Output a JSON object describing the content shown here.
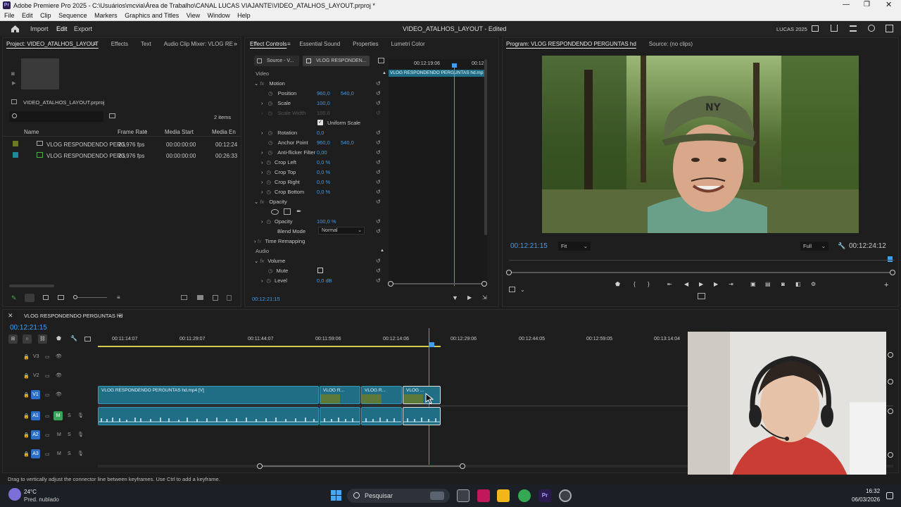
{
  "window": {
    "title": "Adobe Premiere Pro 2025 - C:\\Usuários\\mcvia\\Área de Trabalho\\CANAL LUCAS VIAJANTE\\VIDEO_ATALHOS_LAYOUT.prproj *"
  },
  "menu": [
    "File",
    "Edit",
    "Clip",
    "Sequence",
    "Markers",
    "Graphics and Titles",
    "View",
    "Window",
    "Help"
  ],
  "header": {
    "nav": [
      "Import",
      "Edit",
      "Export"
    ],
    "project_title": "VIDEO_ATALHOS_LAYOUT - Edited",
    "workspace": "LUCAS 2025"
  },
  "project_panel": {
    "tabs": [
      "Project: VIDEO_ATALHOS_LAYOUT",
      "Effects",
      "Text",
      "Audio Clip Mixer: VLOG RE"
    ],
    "file": "VIDEO_ATALHOS_LAYOUT.prproj",
    "item_count": "2 items",
    "columns": [
      "Name",
      "Frame Rate",
      "Media Start",
      "Media En"
    ],
    "rows": [
      {
        "name": "VLOG RESPONDENDO PERG",
        "fps": "23,976 fps",
        "start": "00:00:00:00",
        "end": "00:12:24",
        "color": "#6b7b1e"
      },
      {
        "name": "VLOG RESPONDENDO PERG",
        "fps": "23,976 fps",
        "start": "00:00:00:00",
        "end": "00:26:33",
        "color": "#1f8a9a"
      }
    ]
  },
  "effect_controls": {
    "tabs": [
      "Effect Controls",
      "Essential Sound",
      "Properties",
      "Lumetri Color"
    ],
    "source_label": "Source - V...",
    "clip_label": "VLOG RESPONDEN...",
    "ruler_time_1": "00:12:19:06",
    "ruler_time_2": "00:12:",
    "clip_bar": "VLOG RESPONDENDO PERGUNTAS hd.mp",
    "section_video": "Video",
    "motion": "Motion",
    "position_label": "Position",
    "position_x": "960,0",
    "position_y": "540,0",
    "scale_label": "Scale",
    "scale_val": "100,0",
    "scale_width_label": "Scale Width",
    "scale_width_val": "100,0",
    "uniform_scale": "Uniform Scale",
    "rotation_label": "Rotation",
    "rotation_val": "0,0",
    "anchor_label": "Anchor Point",
    "anchor_x": "960,0",
    "anchor_y": "540,0",
    "antiflicker_label": "Anti-flicker Filter",
    "antiflicker_val": "0,00",
    "crop_left_label": "Crop Left",
    "crop_left_val": "0,0 %",
    "crop_top_label": "Crop Top",
    "crop_top_val": "0,0 %",
    "crop_right_label": "Crop Right",
    "crop_right_val": "0,0 %",
    "crop_bottom_label": "Crop Bottom",
    "crop_bottom_val": "0,0 %",
    "opacity_section": "Opacity",
    "opacity_label": "Opacity",
    "opacity_val": "100,0 %",
    "blend_label": "Blend Mode",
    "blend_val": "Normal",
    "time_remap": "Time Remapping",
    "section_audio": "Audio",
    "volume": "Volume",
    "mute_label": "Mute",
    "level_label": "Level",
    "level_val": "0,0 dB",
    "footer_time": "00:12:21:15"
  },
  "program_monitor": {
    "tabs": [
      "Program: VLOG RESPONDENDO PERGUNTAS hd",
      "Source: (no clips)"
    ],
    "current_time": "00:12:21:15",
    "fit": "Fit",
    "quality": "Full",
    "duration": "00:12:24:12"
  },
  "timeline": {
    "sequence_name": "VLOG RESPONDENDO PERGUNTAS hd",
    "timecode": "00:12:21:15",
    "ruler": [
      "00:11:14:07",
      "00:11:29:07",
      "00:11:44:07",
      "00:11:59:06",
      "00:12:14:06",
      "00:12:29:06",
      "00:12:44:05",
      "00:12:59:05",
      "00:13:14:04"
    ],
    "tracks": [
      "V3",
      "V2",
      "V1",
      "A1",
      "A2",
      "A3"
    ],
    "clip_main": "VLOG RESPONDENDO PERGUNTAS hd.mp4 [V]",
    "clip_short1": "VLOG R...",
    "clip_short2": "VLOG R...",
    "clip_short3": "VLOG ..."
  },
  "status_bar": "Drag to vertically adjust the connector line between keyframes. Use Ctrl to add a keyframe.",
  "taskbar": {
    "weather_temp": "24°C",
    "weather_desc": "Pred. nublado",
    "search": "Pesquisar",
    "time": "16:32",
    "date": "06/03/2026"
  }
}
